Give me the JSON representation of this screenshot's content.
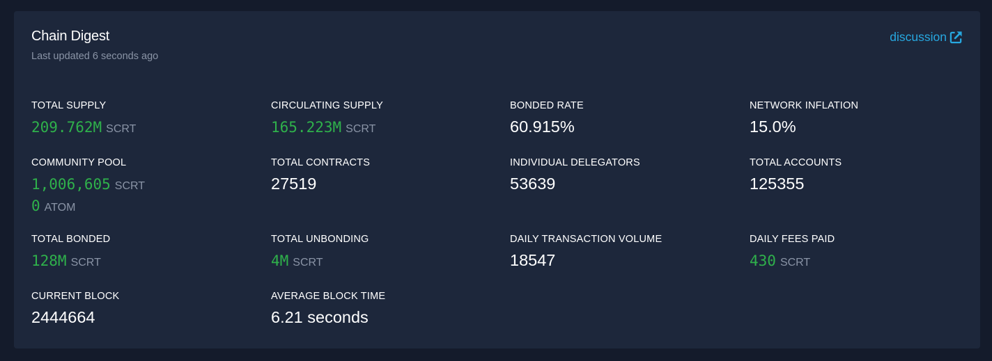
{
  "card": {
    "title": "Chain Digest",
    "subtitle": "Last updated 6 seconds ago",
    "link_label": "discussion",
    "link_icon": "external-link-icon",
    "accent_color": "#27a8e0",
    "amount_color": "#2fb14b"
  },
  "stats": {
    "total_supply": {
      "label": "TOTAL SUPPLY",
      "amount": "209.762M",
      "unit": "SCRT"
    },
    "circulating_supply": {
      "label": "CIRCULATING SUPPLY",
      "amount": "165.223M",
      "unit": "SCRT"
    },
    "bonded_rate": {
      "label": "BONDED RATE",
      "value": "60.915%"
    },
    "network_inflation": {
      "label": "NETWORK INFLATION",
      "value": "15.0%"
    },
    "community_pool": {
      "label": "COMMUNITY POOL",
      "amount": "1,006,605",
      "unit": "SCRT",
      "amount2": "0",
      "unit2": "ATOM"
    },
    "total_contracts": {
      "label": "TOTAL CONTRACTS",
      "value": "27519"
    },
    "individual_delegators": {
      "label": "INDIVIDUAL DELEGATORS",
      "value": "53639"
    },
    "total_accounts": {
      "label": "TOTAL ACCOUNTS",
      "value": "125355"
    },
    "total_bonded": {
      "label": "TOTAL BONDED",
      "amount": "128M",
      "unit": "SCRT"
    },
    "total_unbonding": {
      "label": "TOTAL UNBONDING",
      "amount": "4M",
      "unit": "SCRT"
    },
    "daily_transaction_volume": {
      "label": "DAILY TRANSACTION VOLUME",
      "value": "18547"
    },
    "daily_fees_paid": {
      "label": "DAILY FEES PAID",
      "amount": "430",
      "unit": "SCRT"
    },
    "current_block": {
      "label": "CURRENT BLOCK",
      "value": "2444664"
    },
    "average_block_time": {
      "label": "AVERAGE BLOCK TIME",
      "value": "6.21 seconds"
    }
  }
}
